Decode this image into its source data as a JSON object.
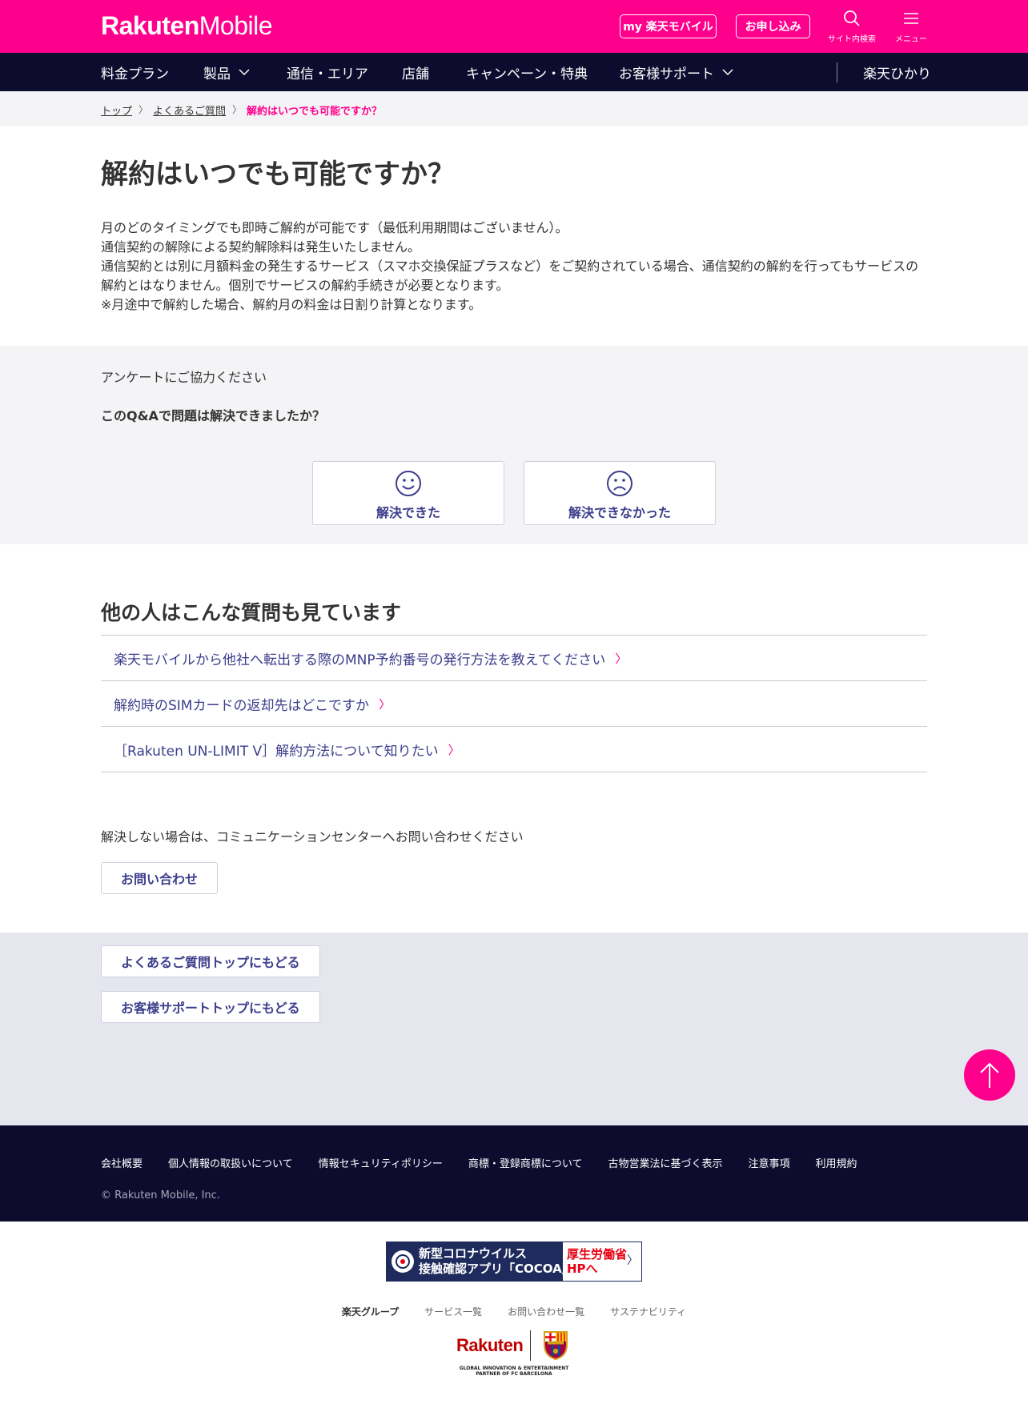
{
  "brand": {
    "name_bold": "Rakuten",
    "name_light": "Mobile"
  },
  "topbar": {
    "my_btn": "my 楽天モバイル",
    "apply_btn": "お申し込み",
    "search_label": "サイト内検索",
    "menu_label": "メニュー"
  },
  "nav": {
    "items": [
      "料金プラン",
      "製品",
      "通信・エリア",
      "店舗",
      "キャンペーン・特典",
      "お客様サポート"
    ],
    "right": "楽天ひかり"
  },
  "breadcrumb": {
    "top": "トップ",
    "faq": "よくあるご質問",
    "current": "解約はいつでも可能ですか？"
  },
  "page": {
    "title": "解約はいつでも可能ですか？",
    "answer": [
      "月のどのタイミングでも即時ご解約が可能です（最低利用期間はございません）。",
      "通信契約の解除による契約解除料は発生いたしません。",
      "通信契約とは別に月額料金の発生するサービス（スマホ交換保証プラスなど）をご契約されている場合、通信契約の解約を行ってもサービスの",
      "解約とはなりません。個別でサービスの解約手続きが必要となります。",
      "※月途中で解約した場合、解約月の料金は日割り計算となります。"
    ]
  },
  "survey": {
    "intro": "アンケートにご協力ください",
    "question": "このQ&Aで問題は解決できましたか？",
    "yes": "解決できた",
    "no": "解決できなかった"
  },
  "related": {
    "title": "他の人はこんな質問も見ています",
    "items": [
      "楽天モバイルから他社へ転出する際のMNP予約番号の発行方法を教えてください",
      "解約時のSIMカードの返却先はどこですか",
      "［Rakuten UN-LIMIT V］解約方法について知りたい"
    ]
  },
  "contact": {
    "text": "解決しない場合は、コミュニケーションセンターへお問い合わせください",
    "button": "お問い合わせ"
  },
  "back": {
    "faq_top": "よくあるご質問トップにもどる",
    "support_top": "お客様サポートトップにもどる"
  },
  "footer": {
    "links": [
      "会社概要",
      "個人情報の取扱いについて",
      "情報セキュリティポリシー",
      "商標・登録商標について",
      "古物営業法に基づく表示",
      "注意事項",
      "利用規約"
    ],
    "copyright": "© Rakuten Mobile, Inc."
  },
  "cocoa": {
    "line1": "新型コロナウイルス",
    "line2": "接触確認アプリ「COCOA」",
    "right1": "厚生労働省",
    "right2": "HPへ"
  },
  "group": {
    "label": "楽天グループ",
    "links": [
      "サービス一覧",
      "お問い合わせ一覧",
      "サステナビリティ"
    ]
  },
  "partner": {
    "logo": "Rakuten",
    "line1": "GLOBAL INNOVATION & ENTERTAINMENT",
    "line2": "PARTNER OF FC BARCELONA"
  },
  "colors": {
    "brand": "#ff008c",
    "navy": "#0d0c2f",
    "link": "#3c3d8c"
  }
}
